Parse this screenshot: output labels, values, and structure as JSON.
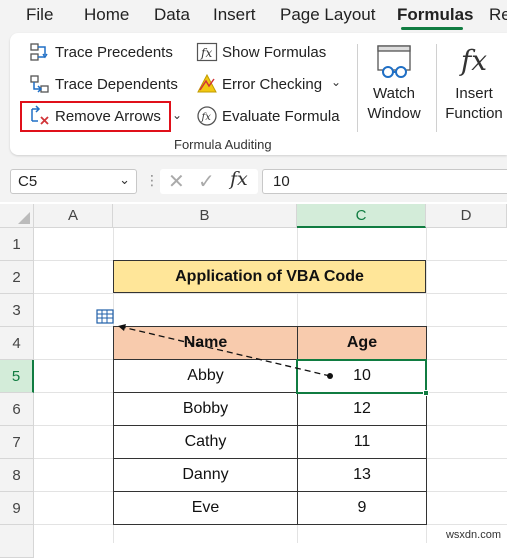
{
  "menu": {
    "tabs": [
      {
        "label": "File",
        "active": false
      },
      {
        "label": "Home",
        "active": false
      },
      {
        "label": "Data",
        "active": false
      },
      {
        "label": "Insert",
        "active": false
      },
      {
        "label": "Page Layout",
        "active": false
      },
      {
        "label": "Formulas",
        "active": true
      },
      {
        "label": "Re",
        "active": false
      }
    ]
  },
  "ribbon": {
    "trace_precedents": "Trace Precedents",
    "trace_dependents": "Trace Dependents",
    "remove_arrows": "Remove Arrows",
    "show_formulas": "Show Formulas",
    "error_checking": "Error Checking",
    "evaluate_formula": "Evaluate Formula",
    "watch_window_line1": "Watch",
    "watch_window_line2": "Window",
    "insert_function_line1": "Insert",
    "insert_function_line2": "Function",
    "group_label": "Formula Auditing",
    "highlight_color": "#e0101a"
  },
  "formula_bar": {
    "name_box": "C5",
    "fx_symbol": "fx",
    "value": "10"
  },
  "sheet": {
    "columns": [
      "A",
      "B",
      "C",
      "D"
    ],
    "selected_column": "C",
    "rows": [
      "1",
      "2",
      "3",
      "4",
      "5",
      "6",
      "7",
      "8",
      "9"
    ],
    "selected_row": "5",
    "title": "Application of VBA Code",
    "table": {
      "headers": [
        "Name",
        "Age"
      ],
      "rows": [
        [
          "Abby",
          "10"
        ],
        [
          "Bobby",
          "12"
        ],
        [
          "Cathy",
          "11"
        ],
        [
          "Danny",
          "13"
        ],
        [
          "Eve",
          "9"
        ]
      ]
    },
    "colors": {
      "title_fill": "#ffe699",
      "header_fill": "#f8cbad",
      "selection": "#107c41"
    }
  },
  "watermark": "wsxdn.com"
}
